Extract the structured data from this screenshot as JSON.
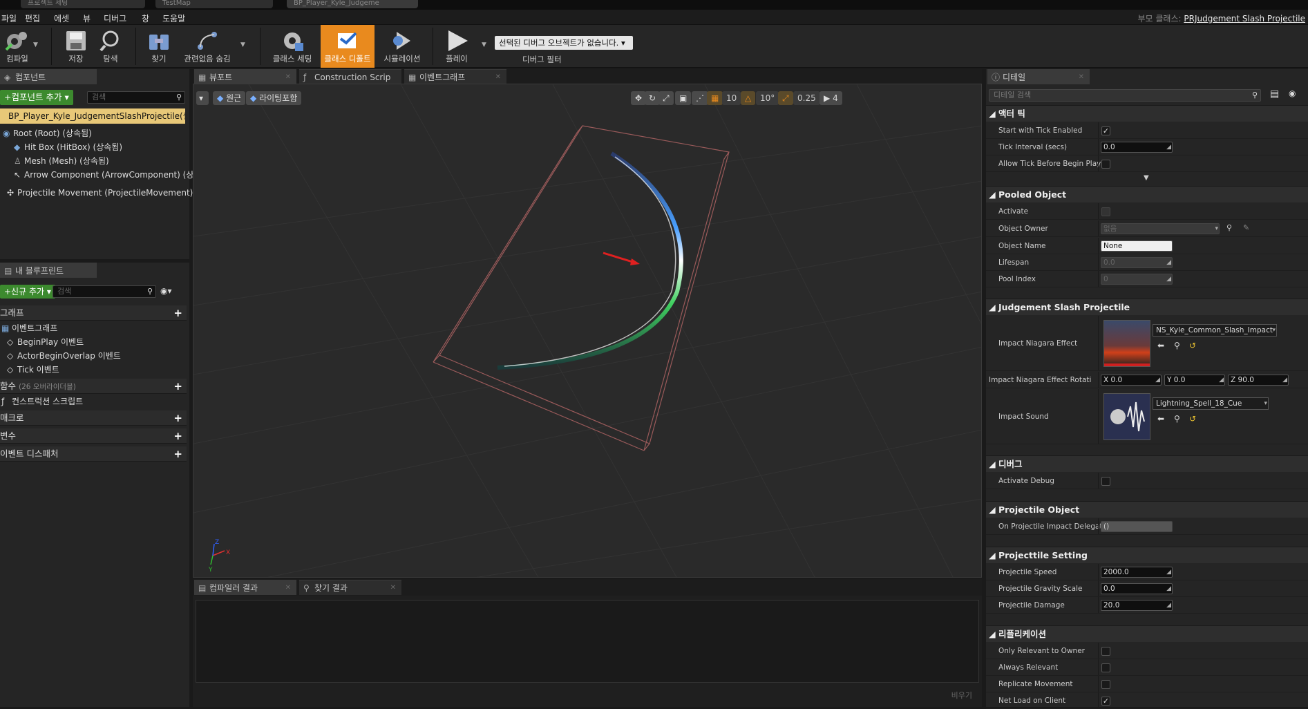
{
  "window_tabs": [
    "프로젝트 세팅",
    "TestMap",
    "BP_Player_Kyle_Judgeme"
  ],
  "menu": [
    "파일",
    "편집",
    "에셋",
    "뷰",
    "디버그",
    "창",
    "도움말"
  ],
  "parent_class": {
    "label": "부모 클래스:",
    "value": "PRJudgement Slash Projectile"
  },
  "toolbar": {
    "compile": "컴파일",
    "save": "저장",
    "browse": "탐색",
    "find": "찾기",
    "hide_unrelated": "관련없음 숨김",
    "class_settings": "클래스 세팅",
    "class_defaults": "클래스 디폴트",
    "simulation": "시뮬레이션",
    "play": "플레이",
    "debug_select": "선택된 디버그 오브젝트가 없습니다.",
    "debug_filter": "디버그 필터"
  },
  "components_panel": {
    "tab": "컴포넌트",
    "add_button": "+컴포넌트 추가",
    "search_placeholder": "검색",
    "root_item": "BP_Player_Kyle_JudgementSlashProjectile(셀프)",
    "tree": [
      "Root (Root) (상속됨)",
      "Hit Box (HitBox) (상속됨)",
      "Mesh (Mesh) (상속됨)",
      "Arrow Component (ArrowComponent) (상속",
      "Projectile Movement (ProjectileMovement) (상"
    ]
  },
  "myblueprint_panel": {
    "tab": "내 블루프린트",
    "add_new": "+신규 추가",
    "search_placeholder": "검색",
    "graph_header": "그래프",
    "event_graph": "이벤트그래프",
    "events": [
      "BeginPlay 이벤트",
      "ActorBeginOverlap 이벤트",
      "Tick 이벤트"
    ],
    "functions": "함수",
    "functions_sub": "(26 오버라이더블)",
    "construction_script": "컨스트럭션 스크립트",
    "macros": "매크로",
    "variables": "변수",
    "event_dispatchers": "이벤트 디스패처"
  },
  "center_tabs": [
    "뷰포트",
    "Construction Scrip",
    "이벤트그래프"
  ],
  "viewport": {
    "perspective": "원근",
    "lighting": "라이팅포함",
    "grid_snap": "10",
    "rot_snap": "10°",
    "scale_snap": "0.25",
    "cam_speed": "4",
    "axis_x": "X",
    "axis_y": "Y",
    "axis_z": "Z"
  },
  "bottom_tabs": [
    "컴파일러 결과",
    "찾기 결과"
  ],
  "clear_button": "비우기",
  "details": {
    "tab": "디테일",
    "search_placeholder": "디테일 검색",
    "sections": {
      "actor_tick": "액터 틱",
      "pooled_object": "Pooled Object",
      "judgement": "Judgement Slash Projectile",
      "debug": "디버그",
      "projectile_object": "Projectile Object",
      "projectile_setting": "Projecttile Setting",
      "replication": "리플리케이션"
    },
    "start_with_tick": "Start with Tick Enabled",
    "tick_interval": "Tick Interval (secs)",
    "tick_interval_val": "0.0",
    "allow_tick": "Allow Tick Before Begin Play",
    "activate": "Activate",
    "object_owner": "Object Owner",
    "object_owner_val": "없음",
    "object_name": "Object Name",
    "object_name_val": "None",
    "lifespan": "Lifespan",
    "lifespan_val": "0.0",
    "pool_index": "Pool Index",
    "pool_index_val": "0",
    "impact_niagara": "Impact Niagara Effect",
    "impact_niagara_val": "NS_Kyle_Common_Slash_Impact",
    "impact_rot": "Impact Niagara Effect Rotati",
    "rot_x": "X 0.0",
    "rot_y": "Y 0.0",
    "rot_z": "Z 90.0",
    "impact_sound": "Impact Sound",
    "impact_sound_val": "Lightning_Spell_18_Cue",
    "activate_debug": "Activate Debug",
    "on_impact": "On Projectile Impact Delegat",
    "on_impact_val": "()",
    "proj_speed": "Projectile Speed",
    "proj_speed_val": "2000.0",
    "proj_gravity": "Projectile Gravity Scale",
    "proj_gravity_val": "0.0",
    "proj_damage": "Projectile Damage",
    "proj_damage_val": "20.0",
    "only_relevant": "Only Relevant to Owner",
    "always_relevant": "Always Relevant",
    "replicate_movement": "Replicate Movement",
    "net_load": "Net Load on Client"
  },
  "colors": {
    "accent_orange": "#e98a1e",
    "green": "#3c8a2e",
    "bg": "#252525"
  }
}
